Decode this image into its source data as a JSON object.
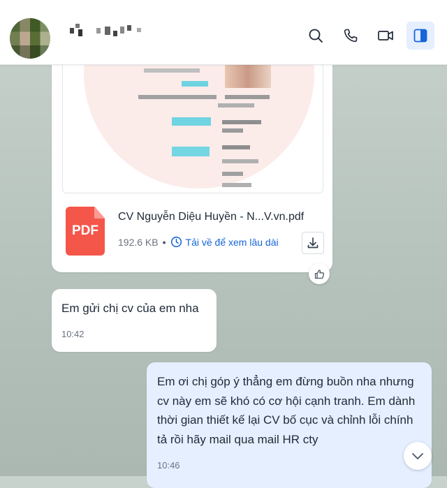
{
  "header": {
    "icons": [
      "search-icon",
      "phone-icon",
      "video-icon",
      "sidebar-toggle-icon"
    ]
  },
  "file_message": {
    "file_name": "CV Nguyễn Diệu Huyền - N...V.vn.pdf",
    "file_type_label": "PDF",
    "file_size": "192.6 KB",
    "separator": "•",
    "keep_link": "Tải về để xem lâu dài"
  },
  "messages": [
    {
      "text": "Em gửi chị cv của em nha",
      "time": "10:42"
    },
    {
      "text": "Em ơi chị góp ý thẳng em đừng buồn nha nhưng cv này em sẽ khó có cơ hội cạnh tranh. Em dành thời gian thiết kế lại CV bố cục và chỉnh lỗi chính tả rồi hãy mail qua mail HR cty",
      "time": "10:46"
    }
  ],
  "colors": {
    "accent": "#1565d8",
    "pdf_red": "#f4564a",
    "outgoing_bubble": "#e5efff"
  }
}
